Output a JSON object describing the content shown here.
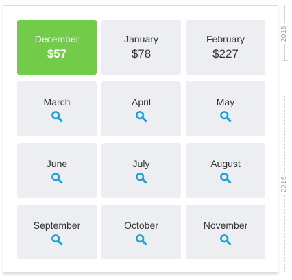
{
  "months": [
    {
      "name": "December",
      "price": "$57",
      "selected": true
    },
    {
      "name": "January",
      "price": "$78",
      "selected": false
    },
    {
      "name": "February",
      "price": "$227",
      "selected": false
    },
    {
      "name": "March",
      "price": null,
      "selected": false
    },
    {
      "name": "April",
      "price": null,
      "selected": false
    },
    {
      "name": "May",
      "price": null,
      "selected": false
    },
    {
      "name": "June",
      "price": null,
      "selected": false
    },
    {
      "name": "July",
      "price": null,
      "selected": false
    },
    {
      "name": "August",
      "price": null,
      "selected": false
    },
    {
      "name": "September",
      "price": null,
      "selected": false
    },
    {
      "name": "October",
      "price": null,
      "selected": false
    },
    {
      "name": "November",
      "price": null,
      "selected": false
    }
  ],
  "timeline": {
    "year_start": "2015",
    "year_next": "2016"
  },
  "colors": {
    "selected": "#72cc4a",
    "cell": "#eceef1",
    "icon": "#1aa3d8"
  },
  "icons": {
    "unpriced": "search-icon"
  }
}
